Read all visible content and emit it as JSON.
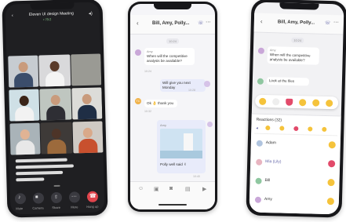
{
  "phone1": {
    "title": "Eleven UI design Meeting",
    "subtitle": "• 70:2",
    "captions": [
      "",
      "",
      "",
      ""
    ],
    "controls": [
      "Mute",
      "Camera",
      "Share",
      "More",
      "Hang up"
    ]
  },
  "phone2": {
    "title": "Bill, Amy, Polly...",
    "date": "10:24",
    "messages": [
      {
        "name": "Amy",
        "text": "When will the competitive analysis be available?",
        "time": "10:24"
      },
      {
        "text": "Will give you next Monday",
        "time": "10:28"
      },
      {
        "name": "TC",
        "text": "Ok 👌 thank you",
        "time": "10:32"
      },
      {
        "caption": "Amy",
        "text": "Polly well said ✌",
        "time": "10:40"
      }
    ]
  },
  "phone3": {
    "title": "Bill, Amy, Polly...",
    "date": "10:24",
    "messages": [
      {
        "name": "Amy",
        "text": "When will the competitive analysis be available?"
      },
      {
        "text": "Look at the files"
      }
    ],
    "reactions_title": "Reactions (32)",
    "people": [
      "Adam",
      "Mia (Lily)",
      "Bill",
      "Amy"
    ]
  },
  "colors": {
    "accent": "#6264a7",
    "bubble_self": "#e8ebfa",
    "hangup": "#e0444c"
  }
}
